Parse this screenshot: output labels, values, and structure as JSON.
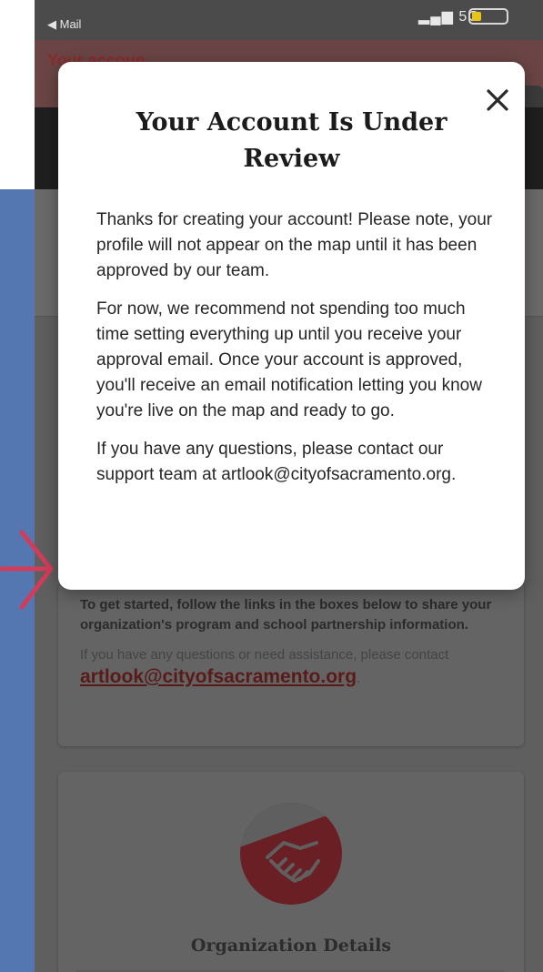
{
  "status_bar": {
    "back_label": "◀ Mail",
    "signal_label": "5G",
    "battery_color": "#e8c419"
  },
  "notice_bar": {
    "text": "Your accoun"
  },
  "modal": {
    "title": "Your Account Is Under Review",
    "paragraphs": [
      "Thanks for creating your account! Please note, your profile will not appear on the map until it has been approved by our team.",
      "For now, we recommend not spending too much time setting everything up until you receive your approval email. Once your account is approved, you'll receive an email notification letting you know you're live on the map and ready to go.",
      "If you have any questions, please contact our support team at artlook@cityofsacramento.org."
    ],
    "close_icon": "close-icon"
  },
  "getting_started_card": {
    "instructions": "To get started, follow the links in the boxes below to share your organization's program and school partnership information.",
    "help_text": "If you have any questions or need assistance, please contact ",
    "email_link": "artlook@cityofsacramento.org",
    "trailing": "."
  },
  "org_card": {
    "icon": "handshake-icon",
    "title": "Organization Details"
  },
  "colors": {
    "overlay": "#5f5f5f",
    "brand_dark_red": "#6a1f25",
    "annotation_blue": "#5577b1",
    "annotation_red": "#d23c5a"
  }
}
